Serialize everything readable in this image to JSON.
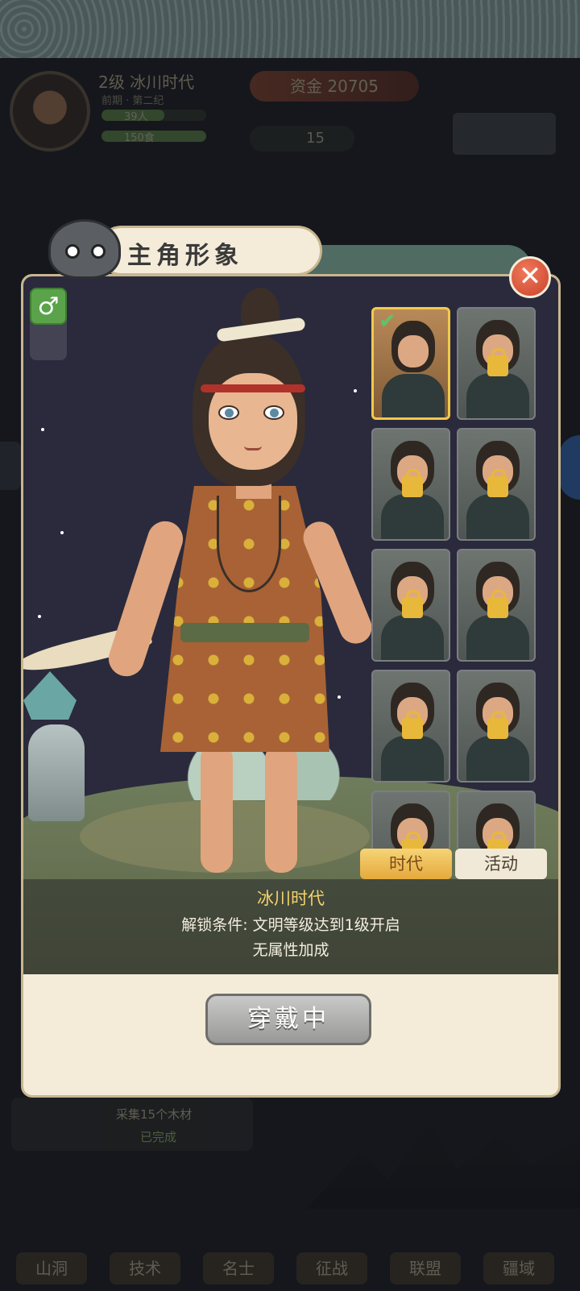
{
  "background": {
    "player": {
      "level_era": "2级 冰川时代",
      "era_sub": "前期 · 第二纪",
      "population": "39人",
      "food": "150食"
    },
    "coins": {
      "label": "资金",
      "value": "20705"
    },
    "resource_count": "15",
    "quest": {
      "title": "采集15个木材",
      "status": "已完成"
    },
    "nav": [
      "山洞",
      "技术",
      "名士",
      "征战",
      "联盟",
      "疆域"
    ]
  },
  "dialog": {
    "title": "主角形象",
    "gender_symbol": "♂",
    "close_symbol": "✕",
    "costumes": [
      {
        "name": "冰川时代",
        "selected": true,
        "locked": false
      },
      {
        "name": "",
        "selected": false,
        "locked": true
      },
      {
        "name": "",
        "selected": false,
        "locked": true
      },
      {
        "name": "",
        "selected": false,
        "locked": true
      },
      {
        "name": "",
        "selected": false,
        "locked": true
      },
      {
        "name": "",
        "selected": false,
        "locked": true
      },
      {
        "name": "",
        "selected": false,
        "locked": true
      },
      {
        "name": "",
        "selected": false,
        "locked": true
      },
      {
        "name": "",
        "selected": false,
        "locked": true
      },
      {
        "name": "",
        "selected": false,
        "locked": true
      }
    ],
    "tabs": {
      "era": "时代",
      "event": "活动",
      "active": "era"
    },
    "info": {
      "name": "冰川时代",
      "unlock_condition": "解锁条件: 文明等级达到1级开启",
      "attribute": "无属性加成"
    },
    "equip_button": "穿戴中",
    "check_symbol": "✔"
  },
  "colors": {
    "accent_gold": "#f1c94b",
    "title_yellow": "#f2d36e",
    "gender_green": "#5aa34a",
    "close_red": "#c9422c"
  }
}
